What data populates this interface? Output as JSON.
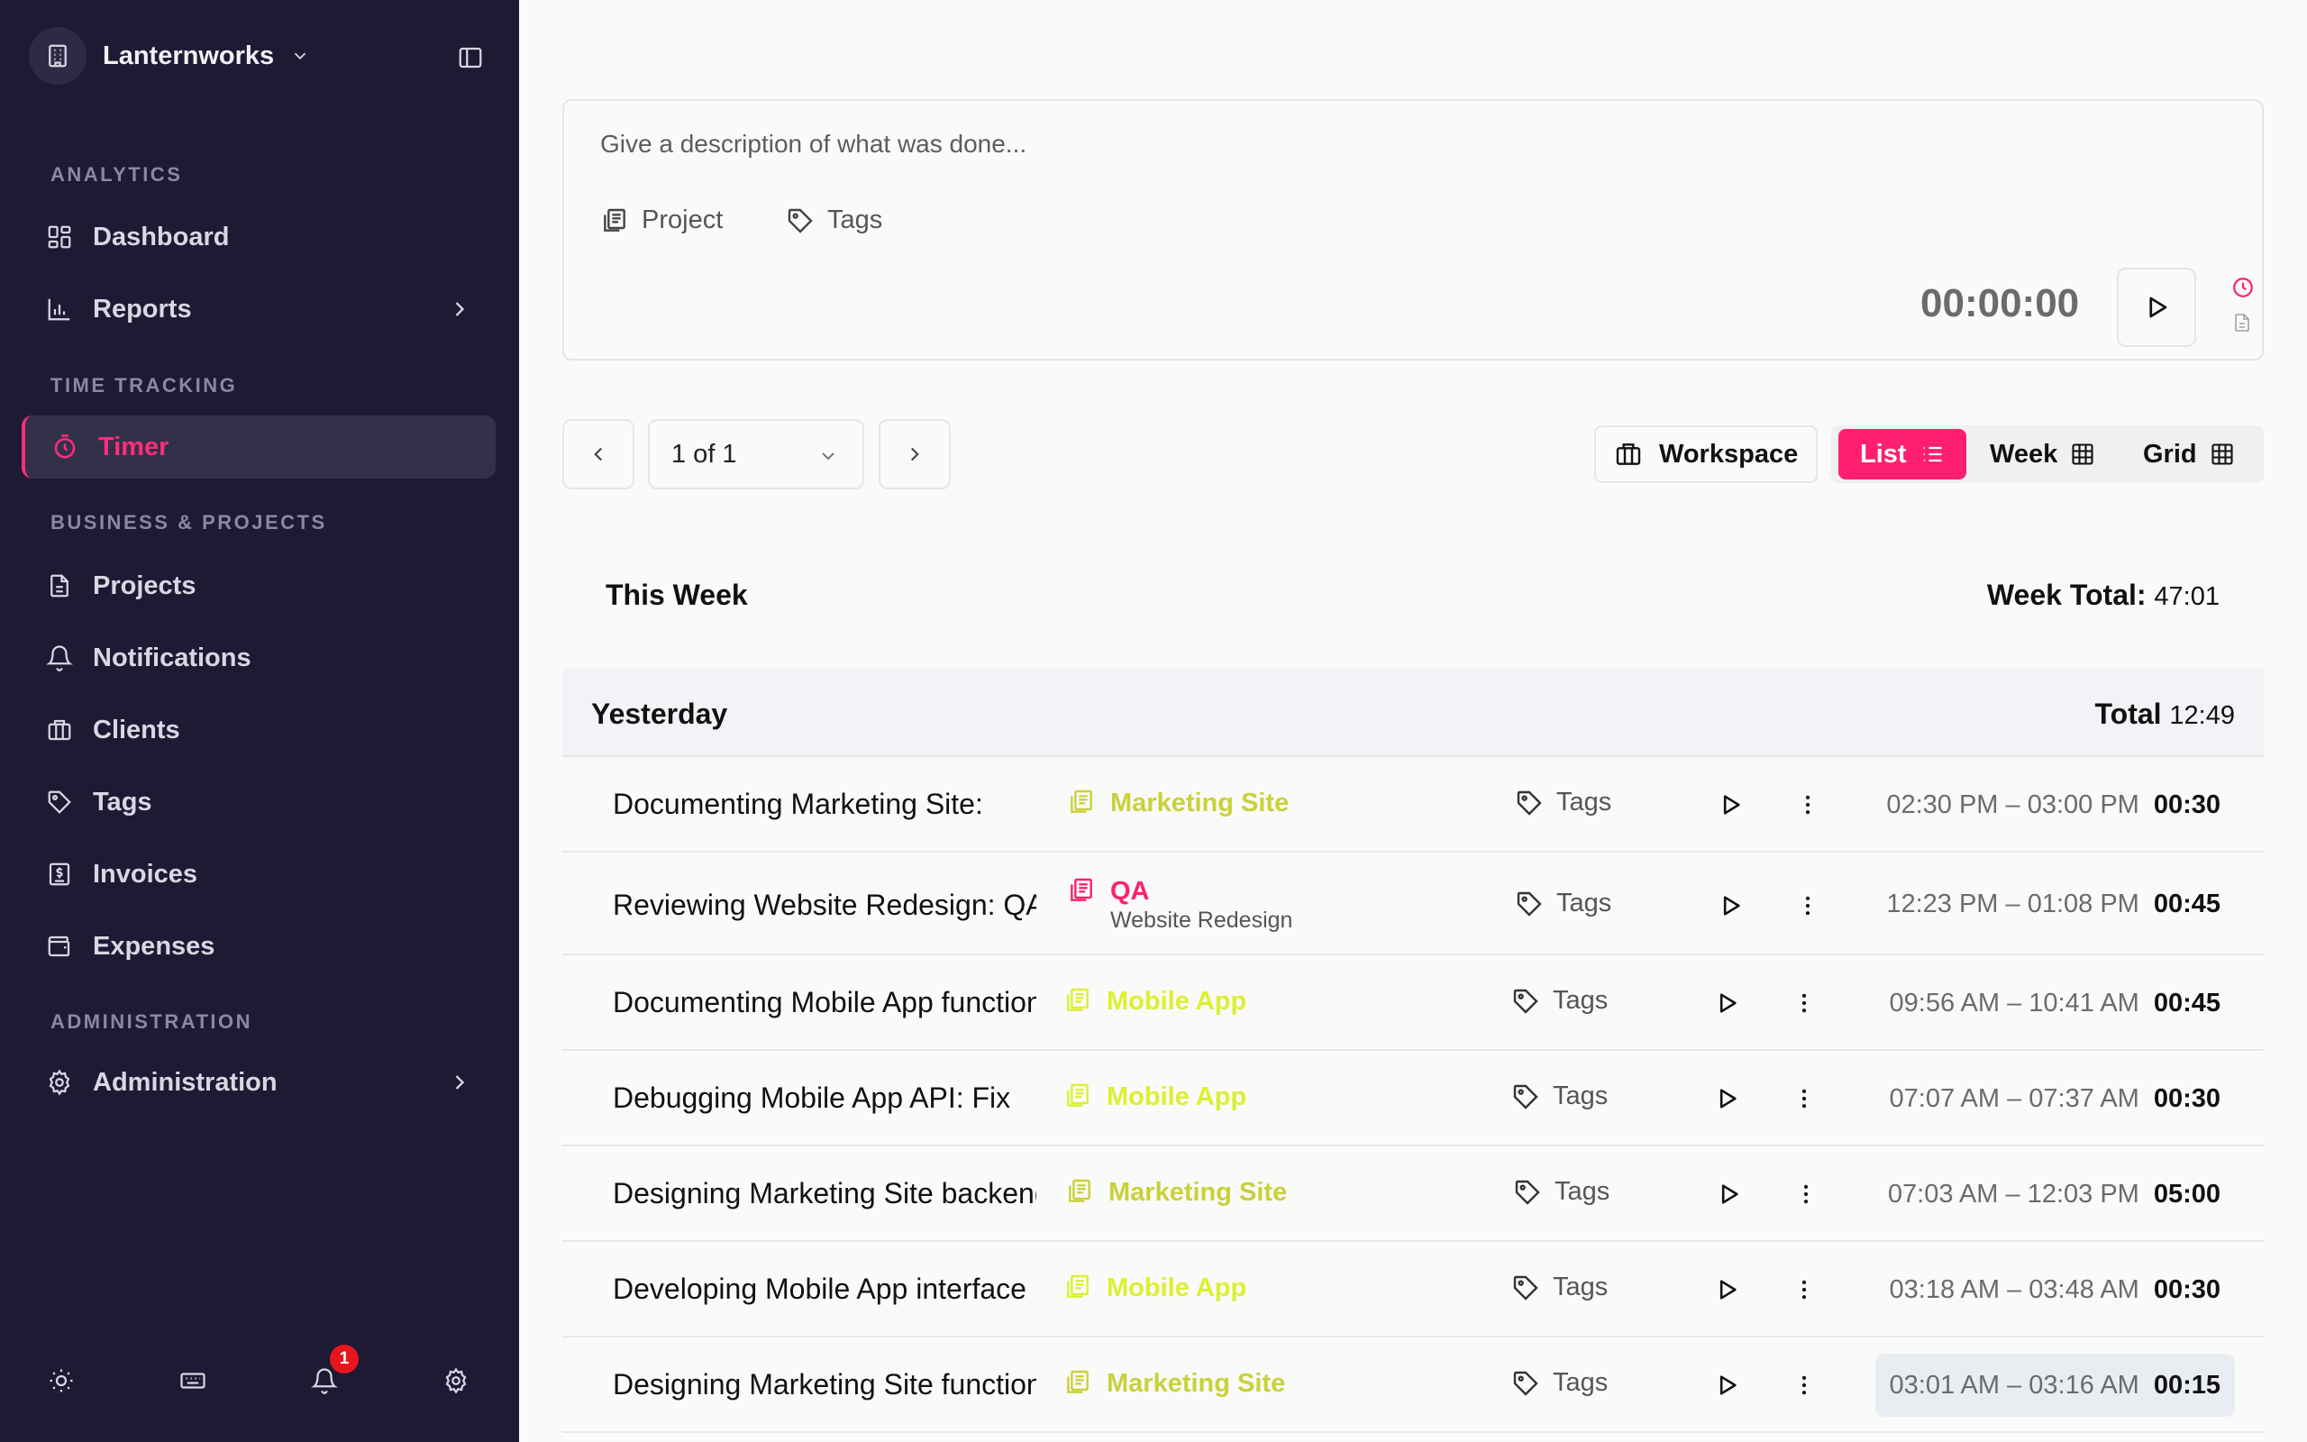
{
  "workspace": {
    "name": "Lanternworks"
  },
  "sidebar": {
    "sections": {
      "analytics": "ANALYTICS",
      "time_tracking": "TIME TRACKING",
      "business": "BUSINESS & PROJECTS",
      "administration": "ADMINISTRATION"
    },
    "items": {
      "dashboard": "Dashboard",
      "reports": "Reports",
      "timer": "Timer",
      "projects": "Projects",
      "notifications": "Notifications",
      "clients": "Clients",
      "tags": "Tags",
      "invoices": "Invoices",
      "expenses": "Expenses",
      "administration": "Administration"
    },
    "notification_count": "1"
  },
  "entry_form": {
    "placeholder": "Give a description of what was done...",
    "project_label": "Project",
    "tags_label": "Tags",
    "timer": "00:00:00"
  },
  "pager": {
    "label": "1 of 1"
  },
  "toolbar": {
    "workspace_label": "Workspace",
    "views": {
      "list": "List",
      "week": "Week",
      "grid": "Grid"
    }
  },
  "week": {
    "title": "This Week",
    "total_label": "Week Total:",
    "total_value": "47:01"
  },
  "day": {
    "title": "Yesterday",
    "total_label": "Total",
    "total_value": "12:49"
  },
  "colors": {
    "accent": "#ff1f6e",
    "sidebar_bg": "#1d1a34",
    "marketing": "#c9d13a",
    "mobile": "#dbf032",
    "qa": "#ff1f6e"
  },
  "entries": [
    {
      "description": "Documenting Marketing Site: ",
      "project": "Marketing Site",
      "tags": "Tags",
      "range": "02:30 PM – 03:00 PM",
      "duration": "00:30"
    },
    {
      "description": "Reviewing Website Redesign: QA",
      "project": "QA",
      "client": "Website Redesign",
      "tags": "Tags",
      "range": "12:23 PM – 01:08 PM",
      "duration": "00:45"
    },
    {
      "description": "Documenting Mobile App functionality",
      "project": "Mobile App",
      "tags": "Tags",
      "range": "09:56 AM – 10:41 AM",
      "duration": "00:45"
    },
    {
      "description": "Debugging Mobile App API: Fix",
      "project": "Mobile App",
      "tags": "Tags",
      "range": "07:07 AM – 07:37 AM",
      "duration": "00:30"
    },
    {
      "description": "Designing Marketing Site backend",
      "project": "Marketing Site",
      "tags": "Tags",
      "range": "07:03 AM – 12:03 PM",
      "duration": "05:00"
    },
    {
      "description": "Developing Mobile App interface",
      "project": "Mobile App",
      "tags": "Tags",
      "range": "03:18 AM – 03:48 AM",
      "duration": "00:30"
    },
    {
      "description": "Designing Marketing Site functionality",
      "project": "Marketing Site",
      "tags": "Tags",
      "range": "03:01 AM – 03:16 AM",
      "duration": "00:15"
    }
  ]
}
